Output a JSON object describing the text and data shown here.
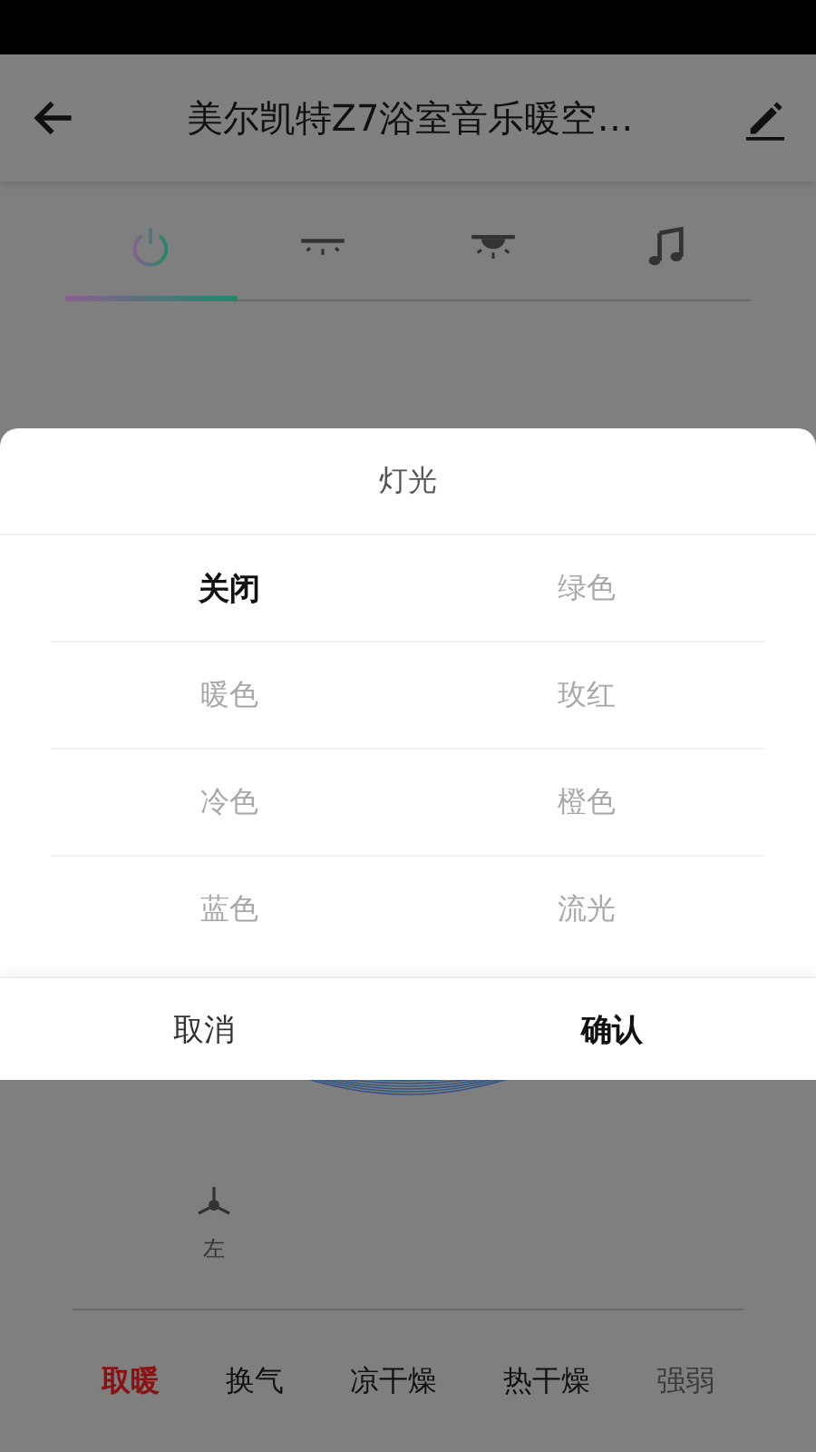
{
  "header": {
    "title": "美尔凯特Z7浴室音乐暖空…"
  },
  "tabs": [
    {
      "kind": "power",
      "selected": true
    },
    {
      "kind": "vent",
      "selected": false
    },
    {
      "kind": "lamp",
      "selected": false
    },
    {
      "kind": "music",
      "selected": false
    }
  ],
  "fan": {
    "label": "左"
  },
  "modes": [
    {
      "label": "取暖",
      "selected": true,
      "disabled": false
    },
    {
      "label": "换气",
      "selected": false,
      "disabled": false
    },
    {
      "label": "凉干燥",
      "selected": false,
      "disabled": false
    },
    {
      "label": "热干燥",
      "selected": false,
      "disabled": false
    },
    {
      "label": "强弱",
      "selected": false,
      "disabled": true
    }
  ],
  "dialog": {
    "title": "灯光",
    "options": [
      [
        {
          "label": "关闭",
          "selected": true
        },
        {
          "label": "绿色",
          "selected": false
        }
      ],
      [
        {
          "label": "暖色",
          "selected": false
        },
        {
          "label": "玫红",
          "selected": false
        }
      ],
      [
        {
          "label": "冷色",
          "selected": false
        },
        {
          "label": "橙色",
          "selected": false
        }
      ],
      [
        {
          "label": "蓝色",
          "selected": false
        },
        {
          "label": "流光",
          "selected": false
        }
      ]
    ],
    "cancel": "取消",
    "confirm": "确认"
  }
}
